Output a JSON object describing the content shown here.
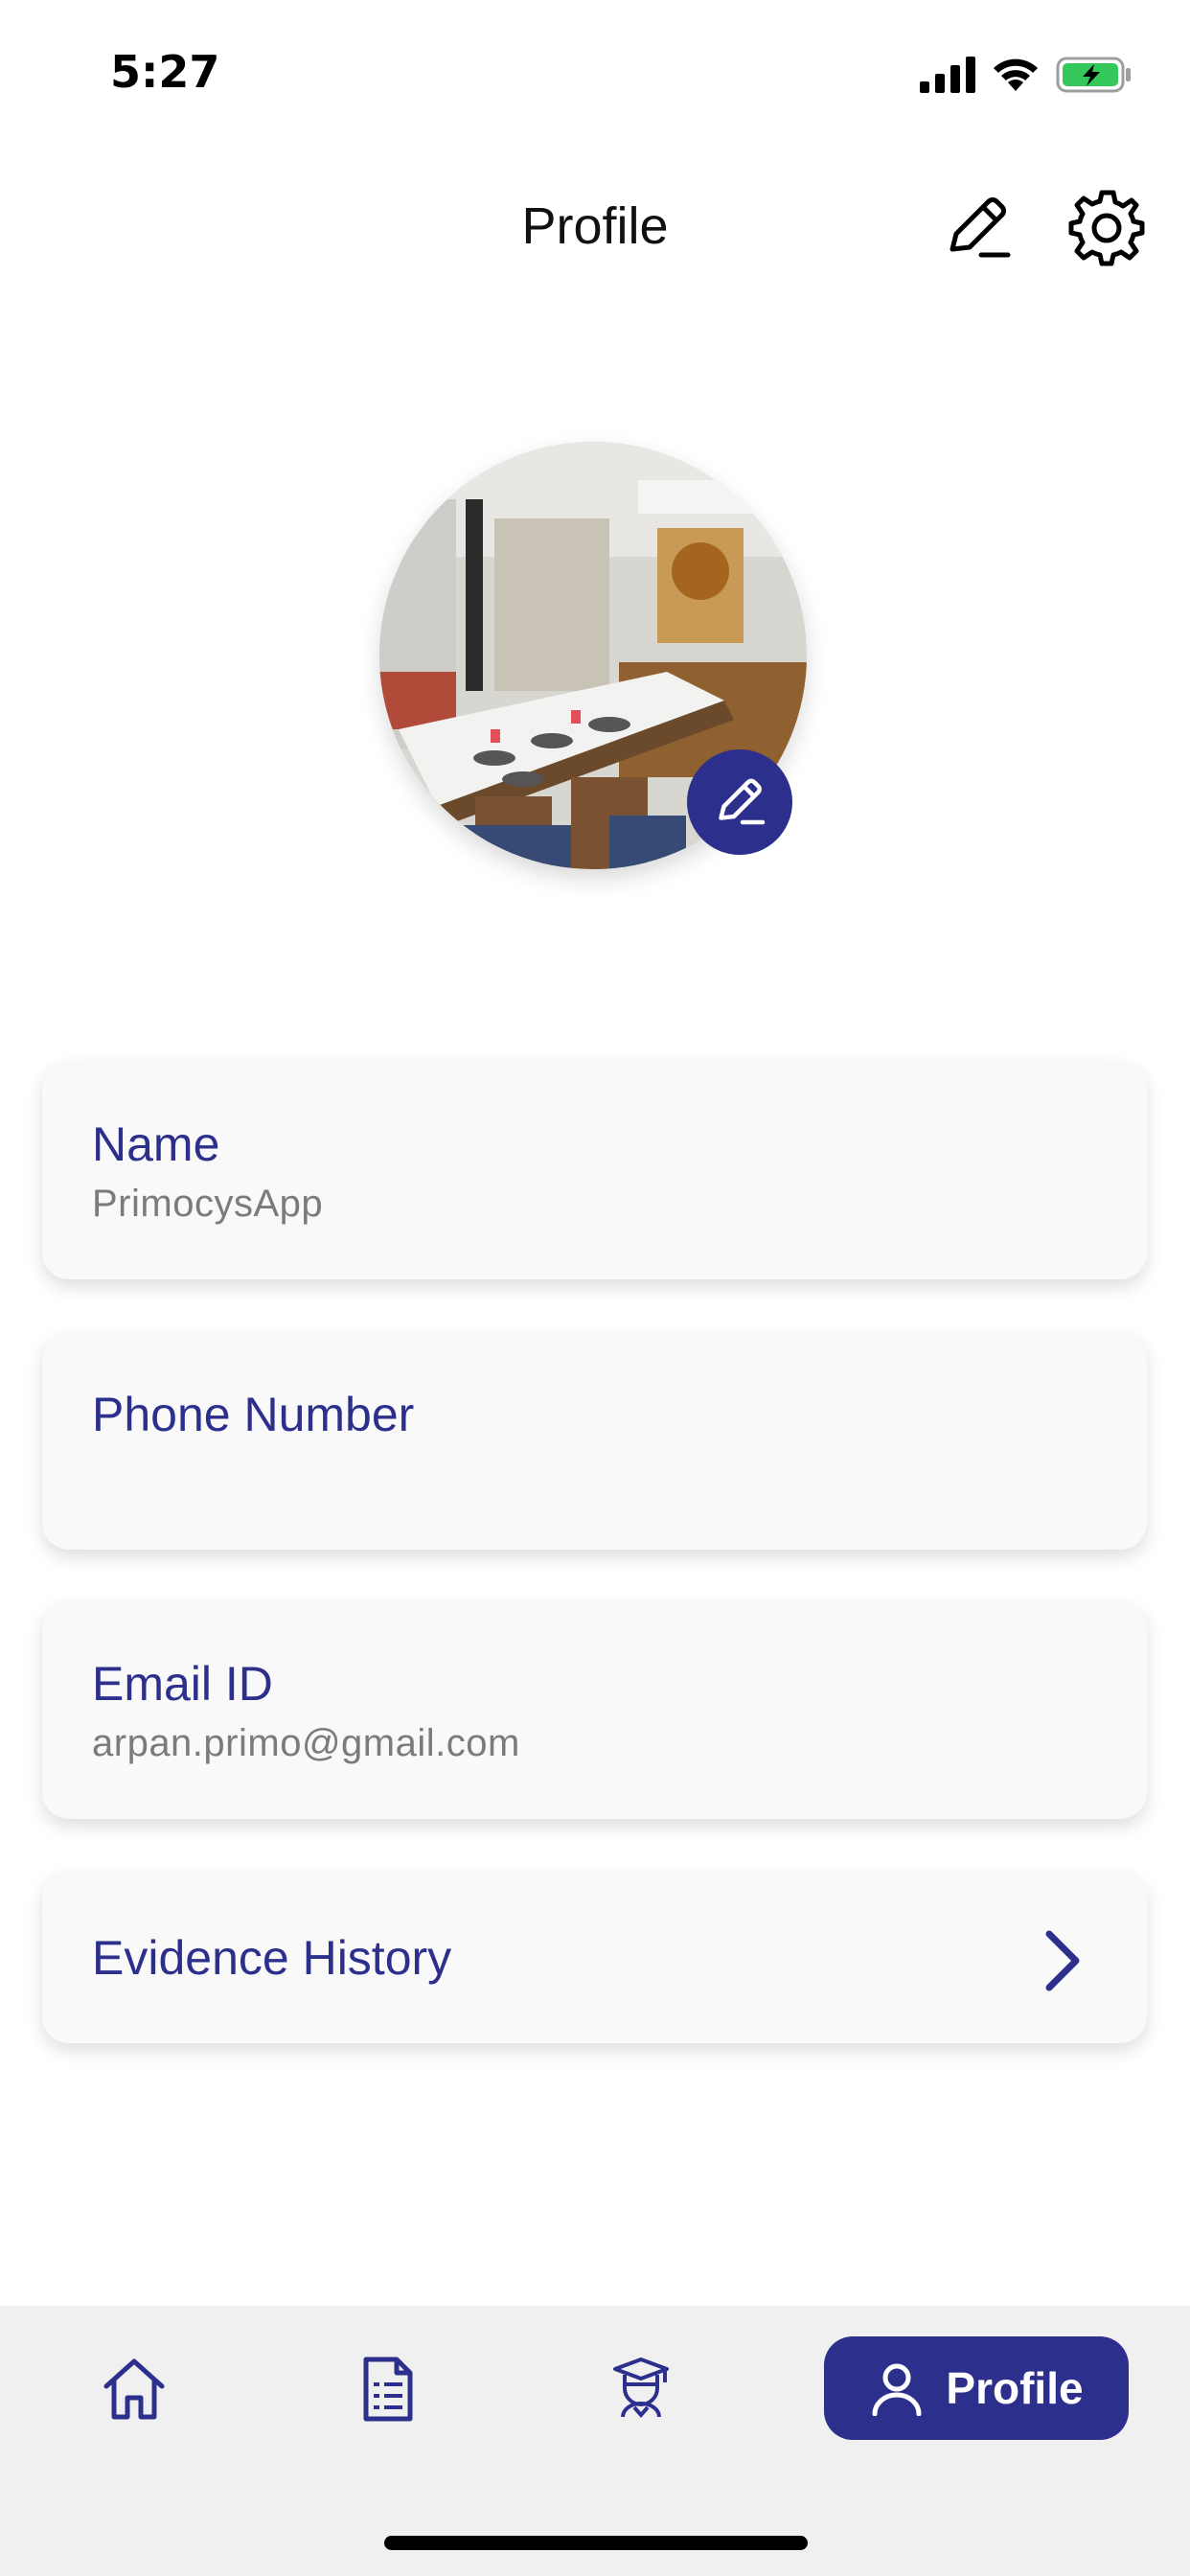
{
  "status_bar": {
    "time": "5:27",
    "icons": [
      "cellular-signal-icon",
      "wifi-icon",
      "battery-charging-icon"
    ]
  },
  "header": {
    "title": "Profile",
    "actions": [
      "edit-icon",
      "settings-icon"
    ]
  },
  "avatar": {
    "description_icon": "profile-photo",
    "edit_icon": "edit-icon"
  },
  "fields": {
    "name": {
      "label": "Name",
      "value": "PrimocysApp"
    },
    "phone": {
      "label": "Phone Number",
      "value": ""
    },
    "email": {
      "label": "Email ID",
      "value": "arpan.primo@gmail.com"
    },
    "evidence": {
      "label": "Evidence History",
      "icon": "chevron-right-icon"
    }
  },
  "bottom_nav": {
    "items": [
      {
        "icon": "home-icon"
      },
      {
        "icon": "document-icon"
      },
      {
        "icon": "graduate-icon"
      },
      {
        "icon": "user-icon",
        "label": "Profile",
        "active": true
      }
    ]
  },
  "colors": {
    "accent": "#2c2f8c",
    "card_background": "#f9f9f9",
    "nav_background": "#f0f0f0",
    "muted_text": "#7b7b7b"
  }
}
